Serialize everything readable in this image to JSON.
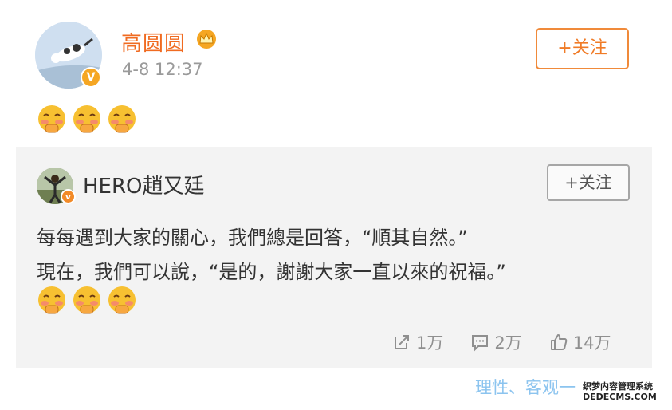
{
  "post": {
    "author": "高圆圆",
    "time": "4-8 12:37",
    "follow_label": "+关注"
  },
  "repost": {
    "author": "HERO趙又廷",
    "follow_label": "+关注",
    "text_line1": "每每遇到大家的關心，我們總是回答，“順其自然。”",
    "text_line2": "現在，我們可以說，“是的，謝謝大家一直以來的祝福。”",
    "shares": "1万",
    "comments": "2万",
    "likes": "14万"
  },
  "watermark": {
    "text": "理性、客观一",
    "site_name": "织梦内容管理系统",
    "site_url": "DEDECMS.COM"
  },
  "icons": {
    "emoji": "blushing-face-emoji",
    "crown": "crown-icon",
    "verified": "verified-badge-icon",
    "share": "share-icon",
    "comment": "comment-icon",
    "like": "like-icon"
  },
  "colors": {
    "accent": "#f06b21",
    "muted": "#9a9a9a",
    "repost_bg": "#f3f3f3"
  }
}
